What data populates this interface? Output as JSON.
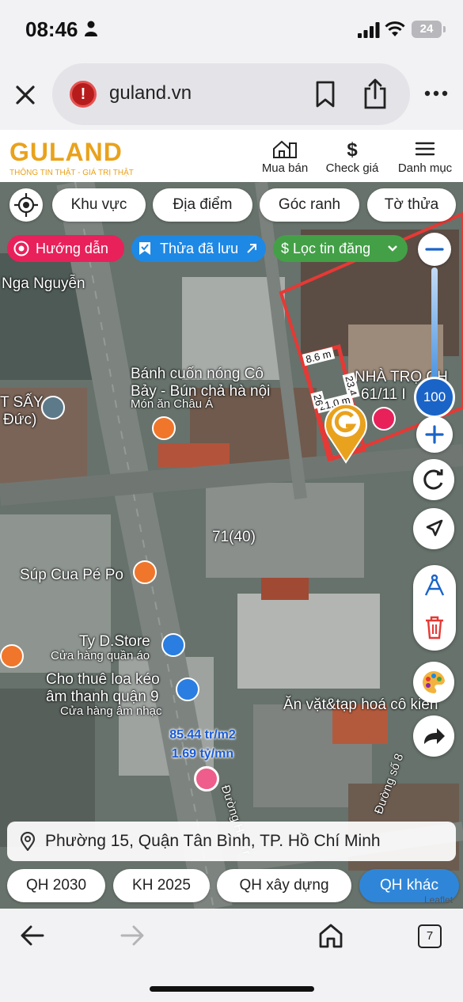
{
  "status": {
    "time": "08:46",
    "battery": "24"
  },
  "browser": {
    "url": "guland.vn"
  },
  "site": {
    "logo_text": "GULAND",
    "logo_tagline": "THÔNG TIN THẬT - GIÁ TRỊ THẬT",
    "nav": [
      "Mua bán",
      "Check giá",
      "Danh mục"
    ]
  },
  "filters": {
    "chips": [
      "Khu vực",
      "Địa điểm",
      "Góc ranh",
      "Tờ thửa"
    ],
    "guide_label": "Hướng dẫn",
    "saved_label": "Thửa đã lưu",
    "filter_label": "$ Lọc tin đăng"
  },
  "map": {
    "zoom_level": "100",
    "labels": [
      "Nga Nguyễn",
      "Bánh cuốn nóng Cô",
      "Bảy - Bún chả hà nội",
      "Món ăn Châu Á",
      "T SẤY",
      "Đức)",
      "NHÀ TRỌ CH",
      "61/11 I",
      "71(40)",
      "Súp Cua Pé Po",
      "Ty D.Store",
      "Cửa hàng quần áo",
      "Cho thuê loa kéo",
      "âm thanh quận 9",
      "Cửa hàng âm nhạc",
      "Ăn vặt&tạp hoá cô kiên",
      "Đường Hải Tr",
      "Đường số 8"
    ],
    "dimensions": [
      "8.6 m",
      "23.4",
      "21.0 m",
      "26"
    ],
    "price_per_m2": "85.44 tr/m2",
    "price_total": "1.69 tỷ/mn",
    "attribution": "Leaflet"
  },
  "address": "Phường 15, Quận Tân Bình, TP. Hồ Chí Minh",
  "layers": [
    "QH 2030",
    "KH 2025",
    "QH xây dựng",
    "QH khác"
  ],
  "tabs_count": "7",
  "colors": {
    "brand": "#e9a21d",
    "parcel_outline": "#e53935",
    "guide_pill": "#e8215b",
    "saved_pill": "#1e88e5",
    "filter_pill": "#43a047",
    "active_layer": "#2f86d8",
    "zoom_value": "#1a64c8"
  },
  "icons": [
    "person-icon",
    "signal-icon",
    "wifi-icon",
    "close-icon",
    "alert-icon",
    "bookmark-icon",
    "share-icon",
    "more-icon",
    "house-icon",
    "dollar-icon",
    "menu-icon",
    "locate-icon",
    "guide-icon",
    "saved-icon",
    "external-link-icon",
    "chevron-down-icon",
    "minus-icon",
    "plus-icon",
    "refresh-icon",
    "navigate-icon",
    "compass-icon",
    "trash-icon",
    "palette-icon",
    "share-arrow-icon",
    "pin-icon",
    "back-icon",
    "forward-icon",
    "home-icon"
  ]
}
